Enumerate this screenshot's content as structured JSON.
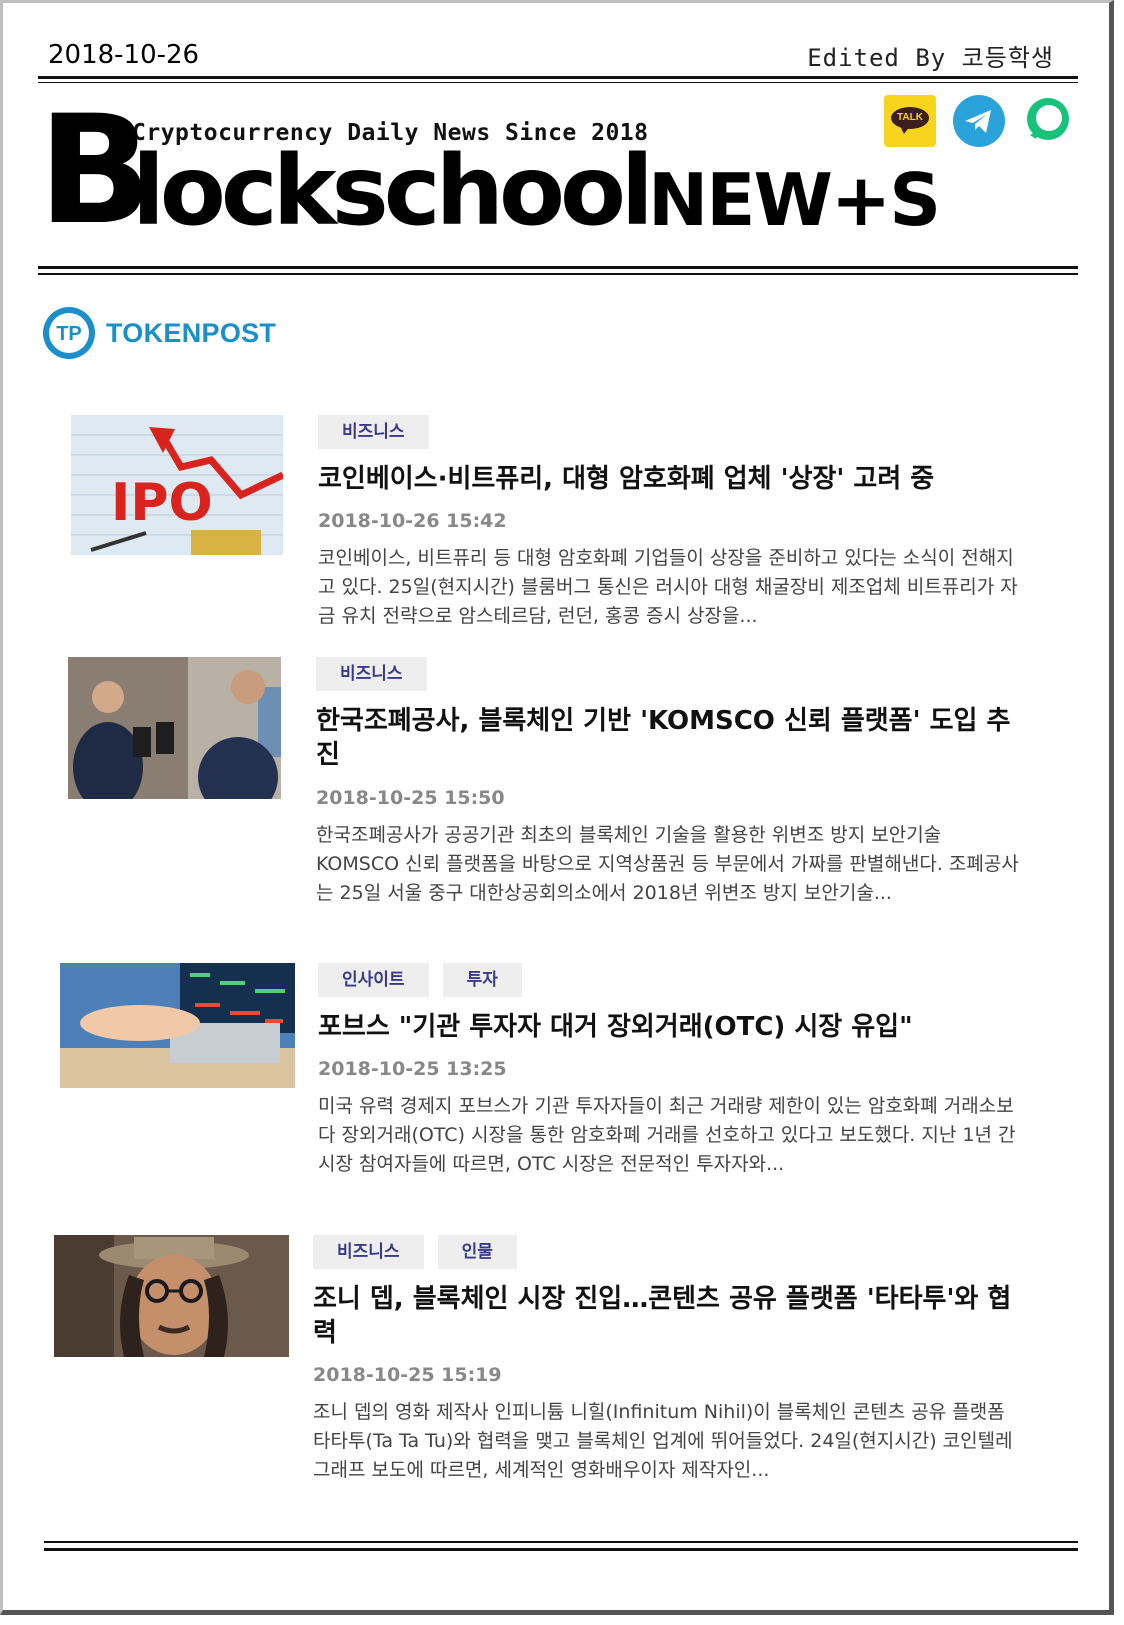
{
  "header": {
    "date": "2018-10-26",
    "editor": "Edited By 코등학생",
    "tagline": "Cryptocurrency Daily News Since 2018",
    "brand_b": "B",
    "brand_rest": "lockschool",
    "brand_news": "NEW+S",
    "social": {
      "talk_label": "TALK",
      "icons": [
        "kakaotalk-icon",
        "telegram-icon",
        "chat-bubble-icon"
      ]
    }
  },
  "source": {
    "name": "TOKENPOST",
    "logo_text": "TP"
  },
  "articles": [
    {
      "tags": [
        "비즈니스"
      ],
      "title": "코인베이스·비트퓨리, 대형 암호화폐 업체 '상장' 고려 중",
      "date": "2018-10-26 15:42",
      "summary": "코인베이스, 비트퓨리 등 대형 암호화폐 기업들이 상장을 준비하고 있다는 소식이 전해지고 있다. 25일(현지시간) 블룸버그 통신은 러시아 대형 채굴장비 제조업체 비트퓨리가 자금 유치 전략으로 암스테르담, 런던, 홍콩 증시 상장을...",
      "image_text": "IPO"
    },
    {
      "tags": [
        "비즈니스"
      ],
      "title": "한국조폐공사, 블록체인 기반 'KOMSCO 신뢰 플랫폼' 도입 추진",
      "date": "2018-10-25 15:50",
      "summary": "한국조폐공사가 공공기관 최초의 블록체인 기술을 활용한 위변조 방지 보안기술 KOMSCO 신뢰 플랫폼을 바탕으로 지역상품권 등 부문에서 가짜를 판별해낸다. 조폐공사는 25일 서울 중구 대한상공회의소에서 2018년 위변조 방지 보안기술..."
    },
    {
      "tags": [
        "인사이트",
        "투자"
      ],
      "title": "포브스 \"기관 투자자 대거 장외거래(OTC) 시장 유입\"",
      "date": "2018-10-25 13:25",
      "summary": "미국 유력 경제지 포브스가 기관 투자자들이 최근 거래량 제한이 있는 암호화폐 거래소보다 장외거래(OTC) 시장을 통한 암호화폐 거래를 선호하고 있다고 보도했다. 지난 1년 간 시장 참여자들에 따르면, OTC 시장은 전문적인 투자자와..."
    },
    {
      "tags": [
        "비즈니스",
        "인물"
      ],
      "title": "조니 뎁, 블록체인 시장 진입…콘텐츠 공유 플랫폼 '타타투'와 협력",
      "date": "2018-10-25 15:19",
      "summary": "조니 뎁의 영화 제작사 인피니튬 니힐(Infinitum Nihil)이 블록체인 콘텐츠 공유 플랫폼 타타투(Ta Ta Tu)와 협력을 맺고 블록체인 업계에 뛰어들었다. 24일(현지시간) 코인텔레그래프 보도에 따르면, 세계적인 영화배우이자 제작자인..."
    }
  ]
}
